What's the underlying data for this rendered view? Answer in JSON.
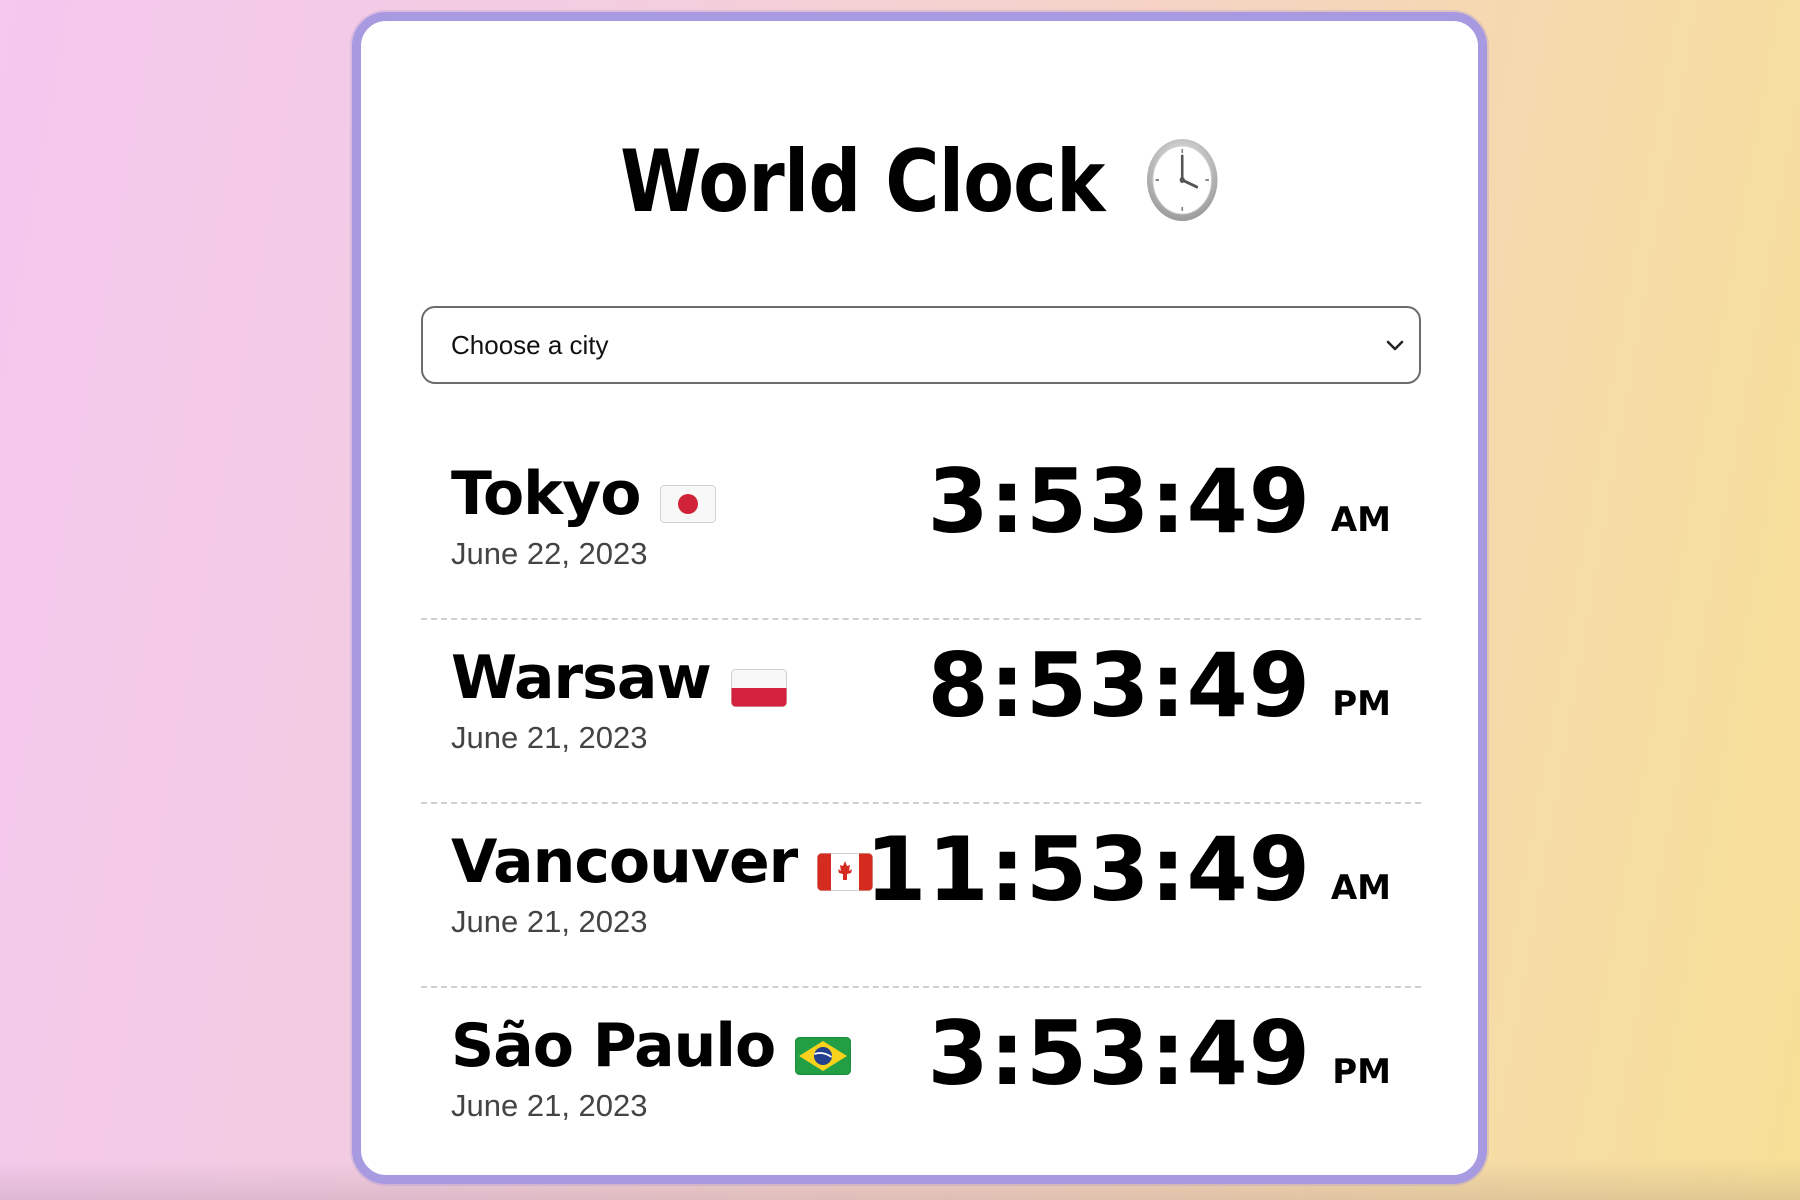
{
  "title": "World Clock",
  "title_icon": "clock-icon",
  "selector": {
    "label": "Choose a city"
  },
  "cities": [
    {
      "name": "Tokyo",
      "flag": "japan-flag-icon",
      "date": "June 22, 2023",
      "time": "3:53:49",
      "ampm": "AM"
    },
    {
      "name": "Warsaw",
      "flag": "poland-flag-icon",
      "date": "June 21, 2023",
      "time": "8:53:49",
      "ampm": "PM"
    },
    {
      "name": "Vancouver",
      "flag": "canada-flag-icon",
      "date": "June 21, 2023",
      "time": "11:53:49",
      "ampm": "AM"
    },
    {
      "name": "São Paulo",
      "flag": "brazil-flag-icon",
      "date": "June 21, 2023",
      "time": "3:53:49",
      "ampm": "PM"
    }
  ],
  "colors": {
    "card_border": "#a79ae0",
    "date_text": "#444444",
    "divider": "#cfcfcf"
  }
}
